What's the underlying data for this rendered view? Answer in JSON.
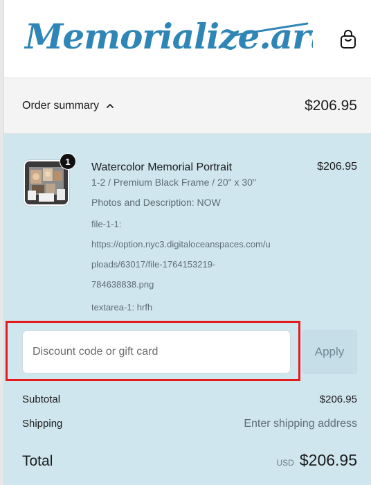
{
  "header": {
    "logo_text": "Memorialize.art",
    "cart_icon": "shopping-bag-icon"
  },
  "summary": {
    "toggle_label": "Order summary",
    "toggle_icon": "chevron-up-icon",
    "total": "$206.95"
  },
  "product": {
    "quantity": "1",
    "title": "Watercolor Memorial Portrait",
    "variant": "1-2 / Premium Black Frame / 20\" x 30\"",
    "property_photos": "Photos and Description: NOW",
    "file_label": "file-1-1:",
    "file_url_line1": "https://option.nyc3.digitaloceanspaces.com/u",
    "file_url_line2": "ploads/63017/file-1764153219-",
    "file_url_line3": "784638838.png",
    "textarea_line": "textarea-1: hrfh",
    "price": "$206.95"
  },
  "discount": {
    "placeholder": "Discount code or gift card",
    "value": "",
    "apply_label": "Apply"
  },
  "totals": {
    "subtotal_label": "Subtotal",
    "subtotal_value": "$206.95",
    "shipping_label": "Shipping",
    "shipping_value": "Enter shipping address",
    "total_label": "Total",
    "currency": "USD",
    "total_value": "$206.95"
  },
  "colors": {
    "brand": "#2f86b6",
    "panel_bg": "#d0e6ef",
    "highlight": "#e51a1a"
  }
}
